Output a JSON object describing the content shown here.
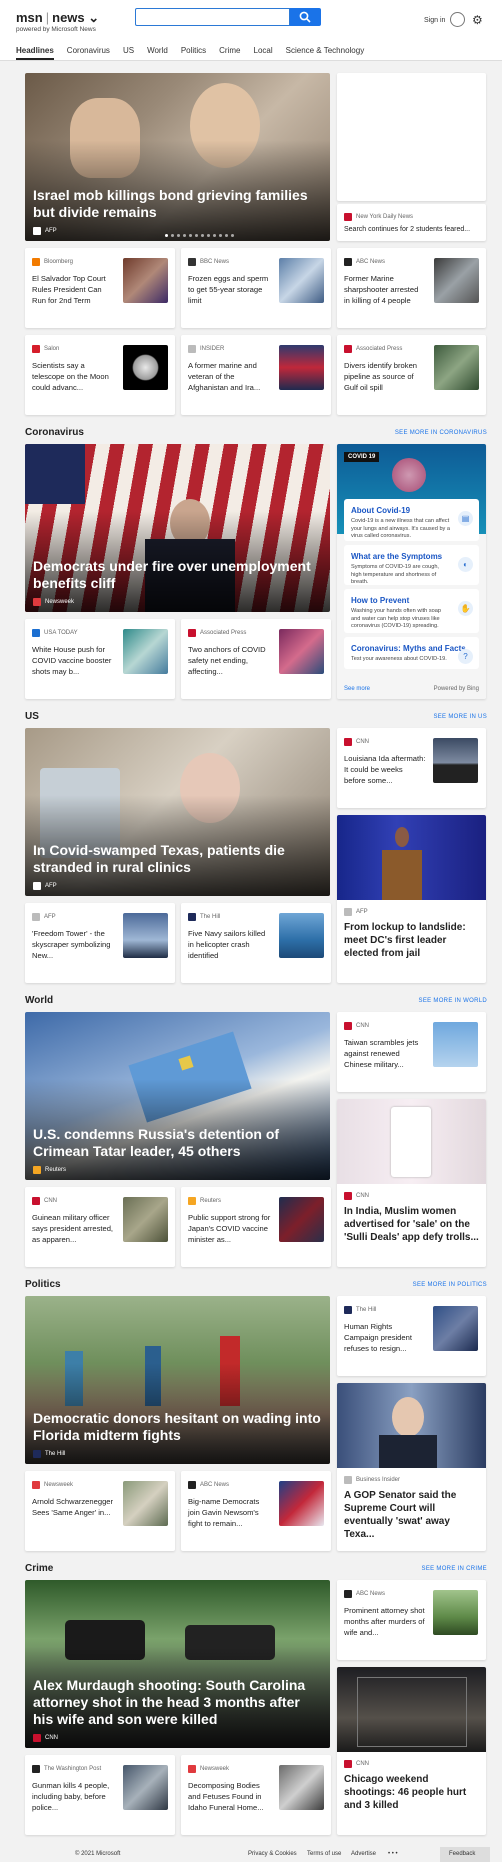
{
  "header": {
    "brand": "msn",
    "section": "news",
    "powered_by": "powered by Microsoft News",
    "search_placeholder": "",
    "signin": "Sign in"
  },
  "nav": [
    "Headlines",
    "Coronavirus",
    "US",
    "World",
    "Politics",
    "Crime",
    "Local",
    "Science & Technology"
  ],
  "top": {
    "hero": {
      "title": "Israel mob killings bond grieving families but divide remains",
      "source": "AFP"
    },
    "right_card": {
      "source": "New York Daily News",
      "title": "Search continues for 2 students feared..."
    },
    "row1": [
      {
        "source": "Bloomberg",
        "title": "El Salvador Top Court Rules President Can Run for 2nd Term"
      },
      {
        "source": "BBC News",
        "title": "Frozen eggs and sperm to get 55-year storage limit"
      },
      {
        "source": "ABC News",
        "title": "Former Marine sharpshooter arrested in killing of 4 people"
      }
    ],
    "row2": [
      {
        "source": "Salon",
        "title": "Scientists say a telescope on the Moon could advanc..."
      },
      {
        "source": "INSIDER",
        "title": "A former marine and veteran of the Afghanistan and Ira..."
      },
      {
        "source": "Associated Press",
        "title": "Divers identify broken pipeline as source of Gulf oil spill"
      }
    ]
  },
  "coronavirus": {
    "label": "Coronavirus",
    "more": "SEE MORE IN CORONAVIRUS",
    "hero": {
      "title": "Democrats under fire over unemployment benefits cliff",
      "source": "Newsweek"
    },
    "panel": {
      "badge": "COVID 19",
      "items": [
        {
          "title": "About Covid-19",
          "desc": "Covid-19 is a new illness that can affect your lungs and airways. It's caused by a virus called coronavirus."
        },
        {
          "title": "What are the Symptoms",
          "desc": "Symptoms of COVID-19 are cough, high temperature and shortness of breath."
        },
        {
          "title": "How to Prevent",
          "desc": "Washing your hands often with soap and water can help stop viruses like coronavirus (COVID-19) spreading."
        },
        {
          "title": "Coronavirus: Myths and Facts",
          "desc": "Test your awareness about COVID-19."
        }
      ],
      "see_more": "See more",
      "powered": "Powered by Bing"
    },
    "row": [
      {
        "source": "USA TODAY",
        "title": "White House push for COVID vaccine booster shots may b..."
      },
      {
        "source": "Associated Press",
        "title": "Two anchors of COVID safety net ending, affecting..."
      }
    ]
  },
  "us": {
    "label": "US",
    "more": "SEE MORE IN US",
    "hero": {
      "title": "In Covid-swamped Texas, patients die stranded in rural clinics",
      "source": "AFP"
    },
    "right_small": {
      "source": "CNN",
      "title": "Louisiana Ida aftermath: It could be weeks before some..."
    },
    "right_tall": {
      "source": "AFP",
      "title": "From lockup to landslide: meet DC's first leader elected from jail"
    },
    "row": [
      {
        "source": "AFP",
        "title": "'Freedom Tower' - the skyscraper symbolizing New..."
      },
      {
        "source": "The Hill",
        "title": "Five Navy sailors killed in helicopter crash identified"
      }
    ]
  },
  "world": {
    "label": "World",
    "more": "SEE MORE IN WORLD",
    "hero": {
      "title": "U.S. condemns Russia's detention of Crimean Tatar leader, 45 others",
      "source": "Reuters"
    },
    "right_small": {
      "source": "CNN",
      "title": "Taiwan scrambles jets against renewed Chinese military..."
    },
    "right_tall": {
      "source": "CNN",
      "title": "In India, Muslim women advertised for 'sale' on the 'Sulli Deals' app defy trolls..."
    },
    "row": [
      {
        "source": "CNN",
        "title": "Guinean military officer says president arrested, as apparen..."
      },
      {
        "source": "Reuters",
        "title": "Public support strong for Japan's COVID vaccine minister as..."
      }
    ]
  },
  "politics": {
    "label": "Politics",
    "more": "SEE MORE IN POLITICS",
    "hero": {
      "title": "Democratic donors hesitant on wading into Florida midterm fights",
      "source": "The Hill"
    },
    "right_small": {
      "source": "The Hill",
      "title": "Human Rights Campaign president refuses to resign..."
    },
    "right_tall": {
      "source": "Business Insider",
      "title": "A GOP Senator said the Supreme Court will eventually 'swat' away Texa..."
    },
    "row": [
      {
        "source": "Newsweek",
        "title": "Arnold Schwarzenegger Sees 'Same Anger' in..."
      },
      {
        "source": "ABC News",
        "title": "Big-name Democrats join Gavin Newsom's fight to remain..."
      }
    ]
  },
  "crime": {
    "label": "Crime",
    "more": "SEE MORE IN CRIME",
    "hero": {
      "title": "Alex Murdaugh shooting: South Carolina attorney shot in the head 3 months after his wife and son were killed",
      "source": "CNN"
    },
    "right_small": {
      "source": "ABC News",
      "title": "Prominent attorney shot months after murders of wife and..."
    },
    "right_tall": {
      "source": "CNN",
      "title": "Chicago weekend shootings: 46 people hurt and 3 killed"
    },
    "row": [
      {
        "source": "The Washington Post",
        "title": "Gunman kills 4 people, including baby, before police..."
      },
      {
        "source": "Newsweek",
        "title": "Decomposing Bodies and Fetuses Found in Idaho Funeral Home..."
      }
    ]
  },
  "footer": {
    "copyright": "© 2021 Microsoft",
    "privacy": "Privacy & Cookies",
    "terms": "Terms of use",
    "advertise": "Advertise",
    "more": "• • •",
    "feedback": "Feedback"
  }
}
